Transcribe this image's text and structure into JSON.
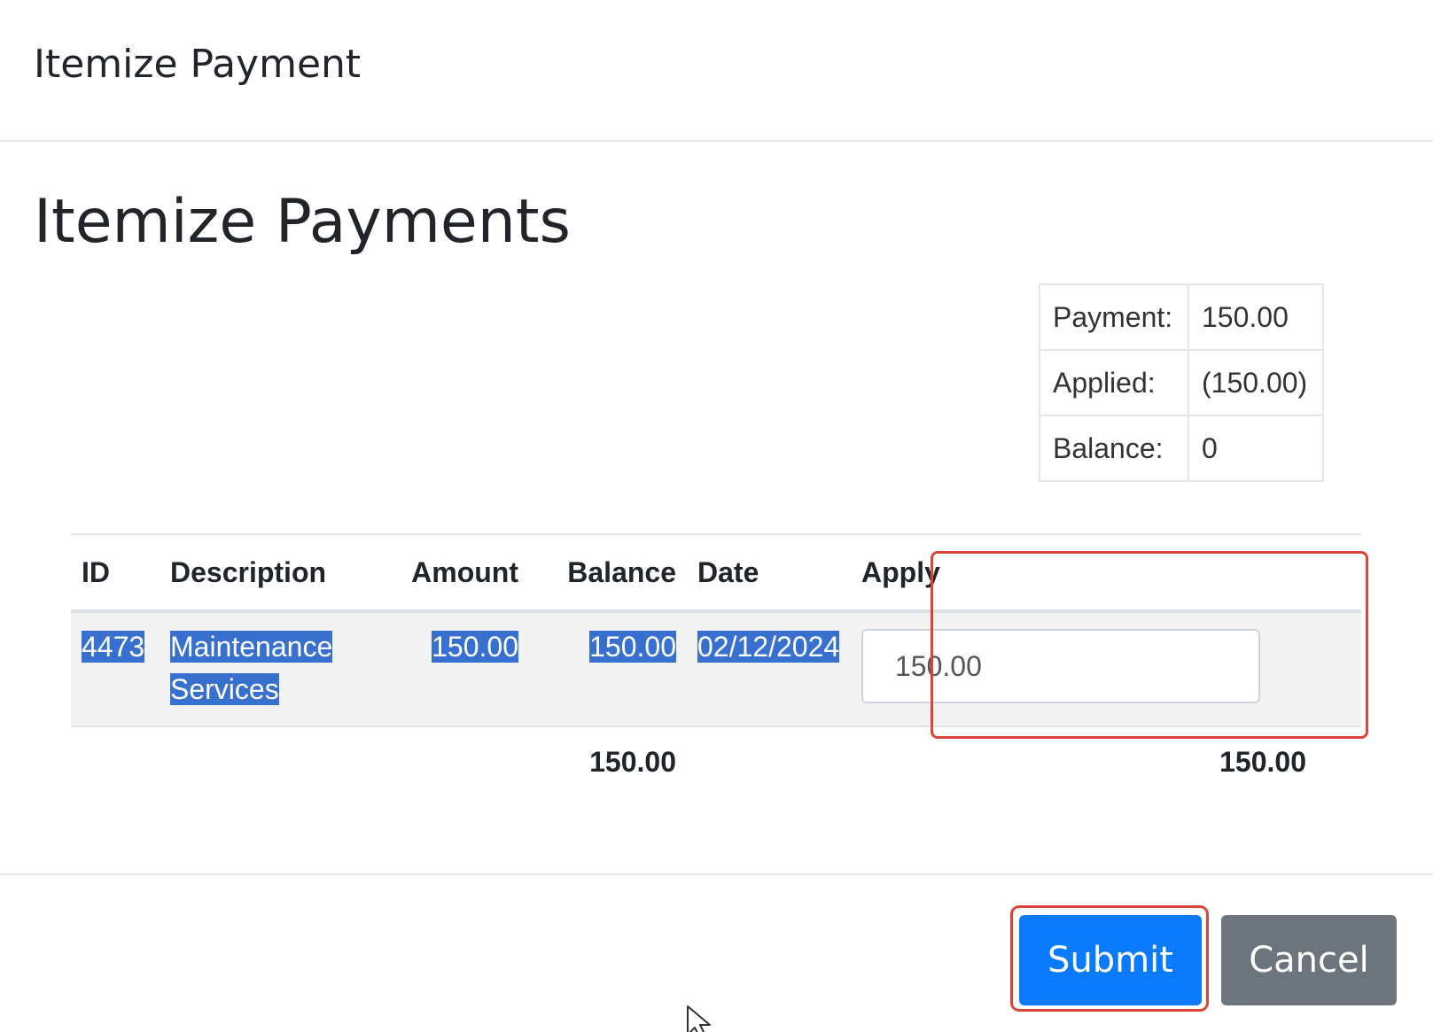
{
  "modal": {
    "title": "Itemize Payment"
  },
  "heading": "Itemize Payments",
  "summary": [
    {
      "label": "Payment:",
      "value": "150.00"
    },
    {
      "label": "Applied:",
      "value": "(150.00)"
    },
    {
      "label": "Balance:",
      "value": "0"
    }
  ],
  "table": {
    "headers": {
      "id": "ID",
      "description": "Description",
      "amount": "Amount",
      "balance": "Balance",
      "date": "Date",
      "apply": "Apply"
    },
    "rows": [
      {
        "id": "4473",
        "description_line1": "Maintenance",
        "description_line2": "Services",
        "amount": "150.00",
        "balance": "150.00",
        "date": "02/12/2024",
        "apply_value": "150.00"
      }
    ],
    "totals": {
      "balance": "150.00",
      "apply": "150.00"
    }
  },
  "buttons": {
    "submit": "Submit",
    "cancel": "Cancel"
  },
  "colors": {
    "primary": "#0a7bff",
    "secondary": "#6c757d",
    "selection": "#3870d0",
    "highlight_box": "#dc4437"
  }
}
